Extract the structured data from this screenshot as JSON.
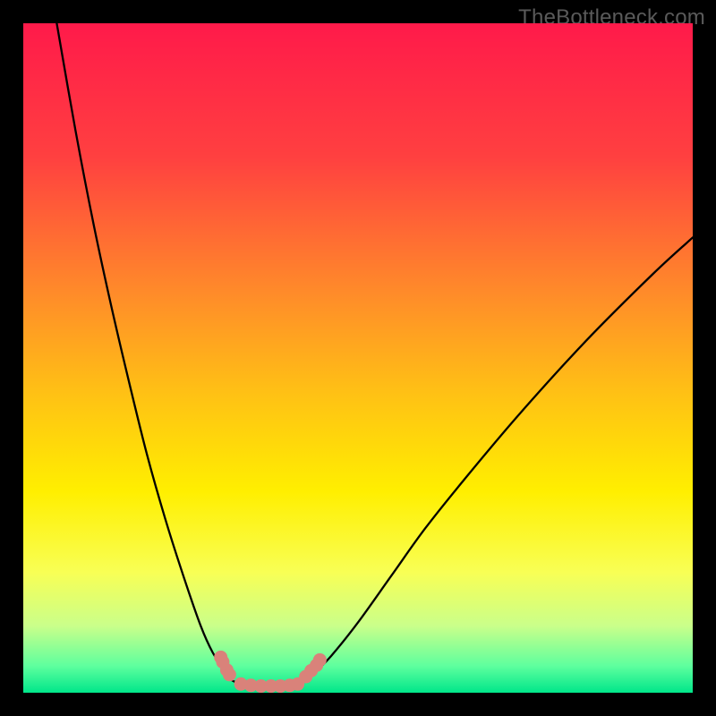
{
  "watermark": "TheBottleneck.com",
  "chart_data": {
    "type": "line",
    "title": "",
    "xlabel": "",
    "ylabel": "",
    "xlim": [
      0,
      100
    ],
    "ylim": [
      0,
      100
    ],
    "grid": false,
    "legend": false,
    "background_gradient": {
      "stops": [
        {
          "offset": 0.0,
          "color": "#ff1a4a"
        },
        {
          "offset": 0.2,
          "color": "#ff4040"
        },
        {
          "offset": 0.4,
          "color": "#ff8a2a"
        },
        {
          "offset": 0.55,
          "color": "#ffc015"
        },
        {
          "offset": 0.7,
          "color": "#ffef00"
        },
        {
          "offset": 0.82,
          "color": "#f8ff55"
        },
        {
          "offset": 0.9,
          "color": "#caff8a"
        },
        {
          "offset": 0.96,
          "color": "#5eff9e"
        },
        {
          "offset": 1.0,
          "color": "#00e68a"
        }
      ]
    },
    "series": [
      {
        "name": "left-curve",
        "x": [
          5.0,
          7.8,
          10.5,
          13.2,
          15.9,
          18.5,
          21.2,
          23.9,
          26.5,
          28.3,
          30.0,
          31.0,
          32.0
        ],
        "y": [
          100.0,
          84.0,
          70.0,
          57.5,
          46.0,
          35.5,
          26.0,
          17.5,
          10.0,
          6.0,
          3.5,
          2.0,
          1.5
        ]
      },
      {
        "name": "floor-segment",
        "x": [
          32.0,
          34.0,
          36.0,
          38.0,
          40.0,
          41.5
        ],
        "y": [
          1.5,
          1.0,
          0.8,
          0.8,
          1.0,
          1.5
        ]
      },
      {
        "name": "right-curve",
        "x": [
          41.5,
          43.5,
          46.0,
          50.0,
          55.0,
          60.0,
          66.0,
          74.0,
          84.0,
          94.0,
          100.0
        ],
        "y": [
          1.5,
          3.0,
          5.5,
          10.5,
          17.5,
          24.5,
          32.0,
          41.5,
          52.5,
          62.5,
          68.0
        ]
      }
    ],
    "markers": [
      {
        "name": "left-marker-cluster",
        "color": "#d9827a",
        "points": [
          {
            "x": 29.5,
            "y": 5.3
          },
          {
            "x": 29.8,
            "y": 4.6
          },
          {
            "x": 30.4,
            "y": 3.4
          },
          {
            "x": 30.8,
            "y": 2.7
          }
        ]
      },
      {
        "name": "right-marker-cluster",
        "color": "#d9827a",
        "points": [
          {
            "x": 42.2,
            "y": 2.4
          },
          {
            "x": 43.0,
            "y": 3.3
          },
          {
            "x": 43.8,
            "y": 4.1
          },
          {
            "x": 44.3,
            "y": 4.9
          }
        ]
      },
      {
        "name": "floor-markers",
        "color": "#d9827a",
        "points": [
          {
            "x": 32.5,
            "y": 1.3
          },
          {
            "x": 34.0,
            "y": 1.1
          },
          {
            "x": 35.5,
            "y": 1.0
          },
          {
            "x": 37.0,
            "y": 1.0
          },
          {
            "x": 38.4,
            "y": 1.0
          },
          {
            "x": 39.8,
            "y": 1.1
          },
          {
            "x": 41.0,
            "y": 1.3
          }
        ]
      }
    ]
  }
}
